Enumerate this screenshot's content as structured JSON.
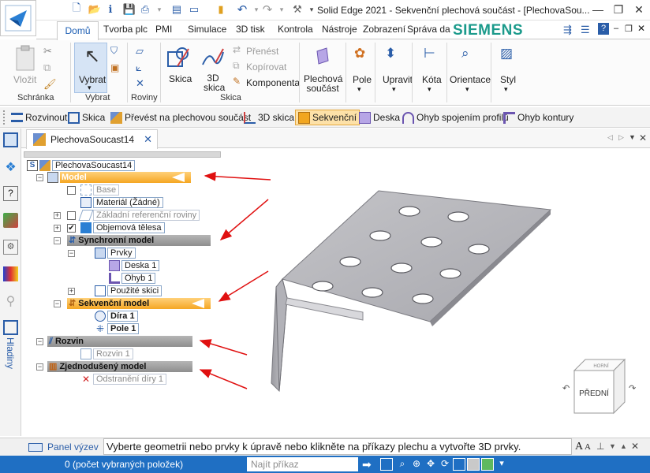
{
  "window": {
    "title": "Solid Edge 2021 - Sekvenční plechová součást - [PlechovaSou..."
  },
  "tabs": [
    "Domů",
    "Tvorba plc",
    "PMI",
    "Simulace",
    "3D tisk",
    "Kontrola",
    "Nástroje",
    "Zobrazení",
    "Správa da"
  ],
  "brand": "SIEMENS",
  "ribbon": {
    "paste": "Vložit",
    "clipboard_group": "Schránka",
    "select": "Vybrat",
    "select_group": "Vybrat",
    "planes_group": "Roviny",
    "sketch": "Skica",
    "sketch3d": "3D skica",
    "transfer": "Přenést",
    "copy": "Kopírovat",
    "component": "Komponenta",
    "sketch_group": "Skica",
    "sheet_part": "Plechová součást",
    "pole": "Pole",
    "modify": "Upravit",
    "dimension": "Kóta",
    "orientation": "Orientace",
    "style": "Styl"
  },
  "commandbar": [
    "Rozvinout",
    "Skica",
    "Převést na plechovou součást",
    "3D skica",
    "Sekvenční",
    "Deska",
    "Ohyb spojením profilů",
    "Ohyb kontury"
  ],
  "doc_tab": "PlechovaSoucast14",
  "side_panel_label": "Hladiny",
  "tree": {
    "root": "PlechovaSoucast14",
    "model": "Model",
    "base": "Base",
    "material": "Materiál (Žádné)",
    "ref_planes": "Základní referenční roviny",
    "bodies": "Objemová tělesa",
    "sync_model": "Synchronní model",
    "features": "Prvky",
    "plate": "Deska 1",
    "bend": "Ohyb 1",
    "used_sketches": "Použité skici",
    "seq_model": "Sekvenční model",
    "hole": "Díra 1",
    "pattern": "Pole 1",
    "flat": "Rozvin",
    "flat1": "Rozvin 1",
    "simplified": "Zjednodušený model",
    "remove_holes": "Odstranění díry 1"
  },
  "viewcube": {
    "front": "PŘEDNÍ",
    "top": "HORNÍ"
  },
  "prompt": {
    "panel": "Panel výzev",
    "text": "Vyberte geometrii nebo prvky k úpravě nebo klikněte na příkazy plechu a vytvořte 3D prvky."
  },
  "status": {
    "selected": "0 (počet vybraných položek)",
    "find_placeholder": "Najít příkaz"
  },
  "colors": {
    "accent": "#1f6fc3",
    "siemens": "#1b9a8b",
    "highlight": "#f5a623",
    "arrow": "#e01010"
  }
}
